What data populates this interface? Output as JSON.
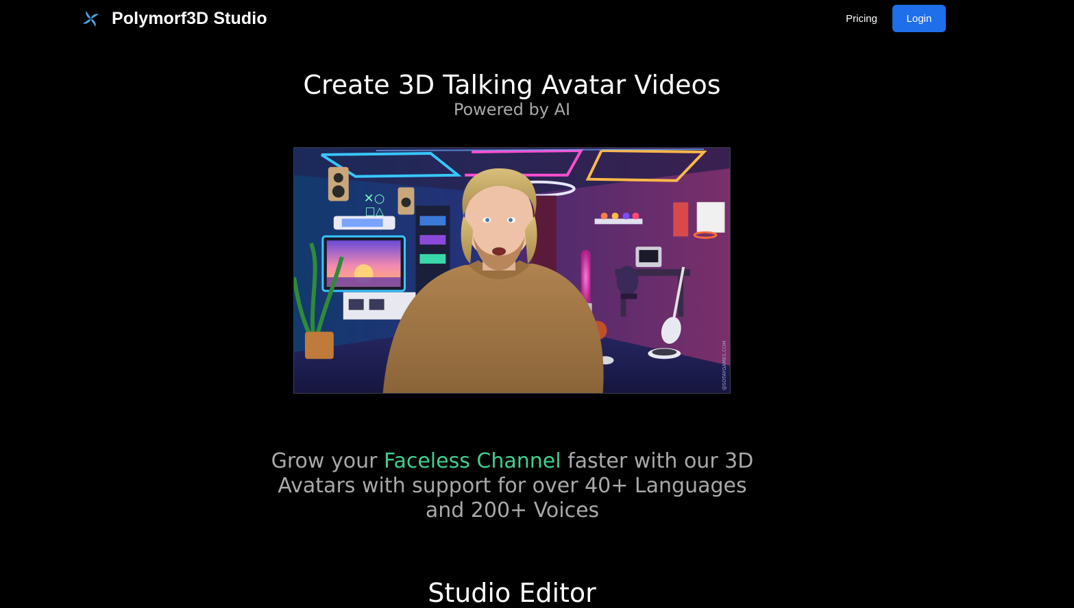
{
  "header": {
    "brand_name": "Polymorf3D Studio",
    "brand_icon": "pinwheel-logo-icon",
    "nav": {
      "pricing_label": "Pricing",
      "login_label": "Login"
    }
  },
  "hero": {
    "title": "Create 3D Talking Avatar Videos",
    "subtitle": "Powered by AI",
    "media_watermark": "@SOTAYGAMES.COM"
  },
  "tagline": {
    "prefix": "Grow your ",
    "highlight": "Faceless Channel",
    "suffix": " faster with our 3D Avatars with support for over 40+ Languages and 200+ Voices"
  },
  "studio": {
    "title": "Studio Editor"
  },
  "colors": {
    "background": "#000000",
    "accent_blue": "#1f6feb",
    "highlight_green": "#3fcf8e",
    "muted_text": "#a9a9a9"
  }
}
